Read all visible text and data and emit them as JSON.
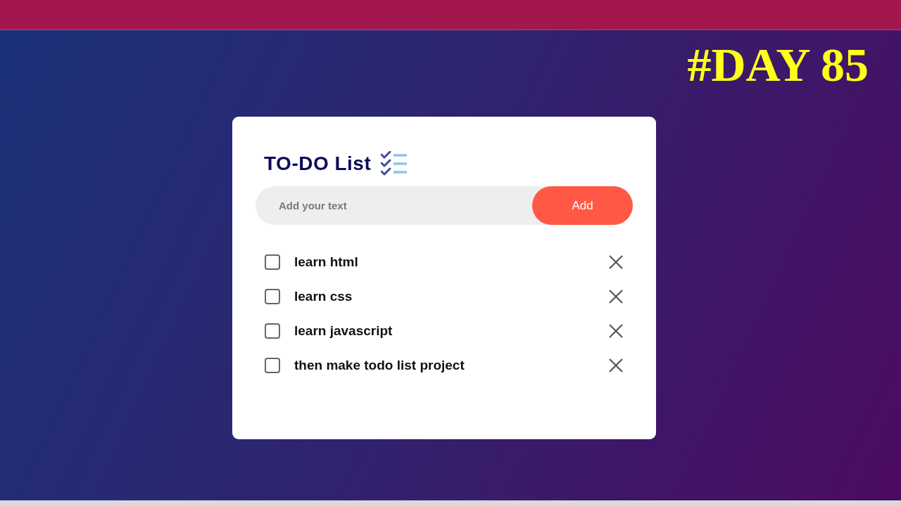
{
  "banner": {
    "title": "#DAY 85"
  },
  "card": {
    "title": "TO-DO List",
    "input": {
      "placeholder": "Add your text"
    },
    "add_button": "Add",
    "tasks": [
      {
        "text": "learn html",
        "checked": false
      },
      {
        "text": "learn css",
        "checked": false
      },
      {
        "text": "learn javascript",
        "checked": false
      },
      {
        "text": "then make todo list project",
        "checked": false
      }
    ]
  }
}
